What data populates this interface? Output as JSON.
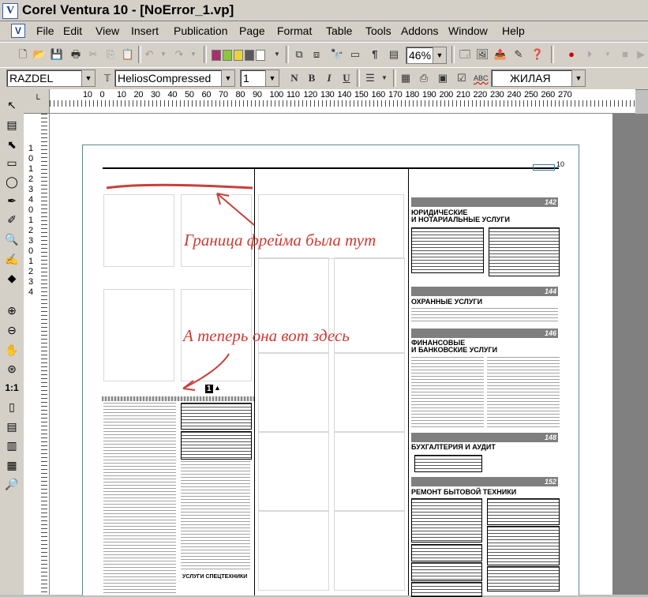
{
  "app": {
    "title": "Corel Ventura 10 - [NoError_1.vp]",
    "icon_letter": "V"
  },
  "menu": [
    "File",
    "Edit",
    "View",
    "Insert",
    "Publication",
    "Page",
    "Format",
    "Table",
    "Tools",
    "Addons",
    "Window",
    "Help"
  ],
  "toolbar": {
    "zoom": "46%",
    "colors": [
      "#a8306a",
      "#8cc63e",
      "#e8d43a",
      "#5a5a5a",
      "#ffffff"
    ]
  },
  "format_bar": {
    "tag": "RAZDEL",
    "font": "HeliosCompressed",
    "size": "1",
    "bold": "B",
    "italic": "I",
    "underline": "U",
    "normal": "N",
    "spell_label": "ABC",
    "language": "ЖИЛАЯ"
  },
  "ruler": {
    "h_ticks": [
      "10",
      "0",
      "10",
      "20",
      "30",
      "40",
      "50",
      "60",
      "70",
      "80",
      "90",
      "100",
      "110",
      "120",
      "130",
      "140",
      "150",
      "160",
      "170",
      "180",
      "190",
      "200",
      "210",
      "220",
      "230",
      "240",
      "250",
      "260",
      "270"
    ],
    "v_ticks": [
      "1",
      "0",
      "1",
      "2",
      "3",
      "4",
      "0",
      "1",
      "2",
      "3",
      "0",
      "1",
      "2",
      "3",
      "4"
    ]
  },
  "annotations": {
    "top": "Граница фрейма была тут",
    "bottom": "А теперь она вот здесь"
  },
  "page": {
    "frame_marker": "1",
    "page_no_top": "10",
    "sections": [
      {
        "number": "142",
        "title_line1": "ЮРИДИЧЕСКИЕ",
        "title_line2": "И НОТАРИАЛЬНЫЕ УСЛУГИ"
      },
      {
        "number": "144",
        "title_line1": "ОХРАННЫЕ УСЛУГИ",
        "title_line2": ""
      },
      {
        "number": "146",
        "title_line1": "ФИНАНСОВЫЕ",
        "title_line2": "И БАНКОВСКИЕ УСЛУГИ"
      },
      {
        "number": "148",
        "title_line1": "БУХГАЛТЕРИЯ И АУДИТ",
        "title_line2": ""
      },
      {
        "number": "152",
        "title_line1": "РЕМОНТ БЫТОВОЙ ТЕХНИКИ",
        "title_line2": ""
      }
    ],
    "services_heading": "УСЛУГИ СПЕЦТЕХНИКИ"
  }
}
